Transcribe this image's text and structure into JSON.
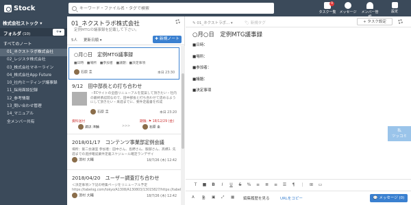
{
  "app": {
    "name": "Stock"
  },
  "search": {
    "placeholder": "キーワード・ファイル名・タグで検索"
  },
  "toolbar": {
    "tasks_label": "タスク一覧",
    "messages_label": "メッセージ",
    "members_label": "メンバー管理",
    "settings_label": "設定",
    "tasks_badge": "9"
  },
  "sidebar": {
    "stock_name": "株式会社ストック ▾",
    "folder_label": "フォルダ",
    "folder_count": "(10)",
    "add_label": "+▾",
    "all_notes": "すべてのノート",
    "folders": [
      "01_ネクストラボ株式会社",
      "02_レジスタ株式会社",
      "03_株式会社マネーライン",
      "04_株式会社App Future",
      "10_社内ミーティング議事録",
      "11_採用面談記録",
      "12_参考情報",
      "13_問い合わせ管理",
      "14_マニュアル",
      "全メンバー共有"
    ]
  },
  "notes": {
    "title": "01_ネクストラボ株式会社",
    "description": "定例MTGの議事録を記載して下さい。",
    "member_count": "5人",
    "sort_label": "更新日順 ▾",
    "new_button": "✚ 新規ノート",
    "cards": [
      {
        "title": "○月○日　定例MTG議事録",
        "sub": "■日時　■場所　■参加者　■議題：■決定事項",
        "author": "石原 圭",
        "date": "本日 23:30"
      },
      {
        "title": "9/12　田中部長との打ち合わせ",
        "excerpt": "・ECサイトの全面リニューアルを提案して頂きたい・社内の最終承認前なので、田中部長と打ち合わせて詰めるようにして頂きたい・来週までに、要件定義書を作成",
        "author": "石原 圭",
        "date": "本日 23:20",
        "task_label": "資料送付",
        "task_assignee": "渡辺 洋輔",
        "task_due_label": "期限:",
        "task_due": "18/12/29 (金)",
        "task_owner": "石原 圭"
      },
      {
        "title": "2018/01/17　コンテンツ事業部定例会議",
        "excerpt": "場所：第二会議室 参加者：田中さん、島野さん、服部さん、高橋1. 先週までの進捗確認業件定義スケジュール確定ランデザイ",
        "author": "澤村 大輔",
        "date": "18/7/26 (木) 12:42"
      },
      {
        "title": "2018/04/20　ユーザー調査打ち合わせ",
        "excerpt": "＜決定事項＞下記の特集ページをリニューアル予定https://tabelog.com/tokyo/A1308/A130803/13015827/https://tabelog.com/t",
        "author": "澤村 大輔",
        "date": "18/7/26 (木) 12:42"
      }
    ]
  },
  "editor": {
    "breadcrumb": "01_ネクストラボ... ▾",
    "tag_placeholder": "新規タグ",
    "task_button": "+ タスク設定",
    "title": "○月○日　定例MTG議事録",
    "lines": [
      "■日時：",
      "■場所：",
      "■参加者：",
      "■議題：",
      "■決定事項"
    ],
    "history_label": "編集履歴を見る",
    "url_copy_label": "URLをコピー",
    "message_button": "💬 メッセージ (0)",
    "format_tools": [
      "T",
      "■",
      "B",
      "I",
      "U",
      "S",
      "%",
      "≡",
      "≣",
      "≡",
      "☰",
      "¶",
      "⋮",
      "⊞",
      "▭"
    ]
  },
  "side_tab": {
    "line1": "私",
    "line2": "ツッコミ"
  }
}
